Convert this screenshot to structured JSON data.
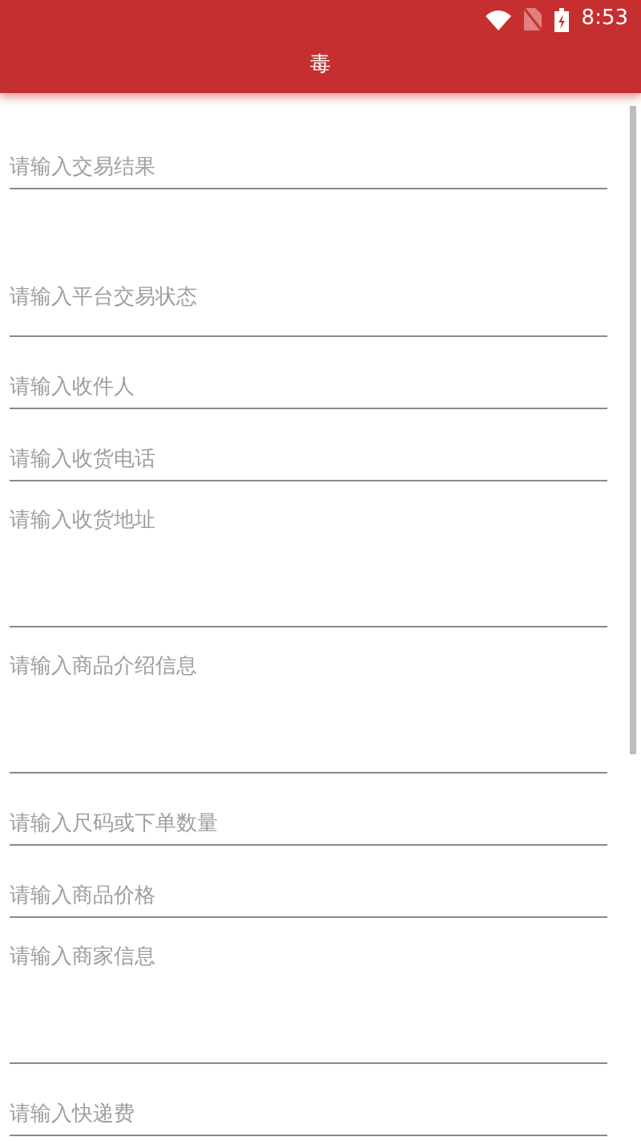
{
  "status_bar": {
    "time": "8:53"
  },
  "toolbar": {
    "title": "毒"
  },
  "fields": [
    {
      "kind": "first",
      "placeholder": "请输入交易结果"
    },
    {
      "kind": "tall",
      "placeholder": "请输入平台交易状态"
    },
    {
      "kind": "single",
      "placeholder": "请输入收件人"
    },
    {
      "kind": "single",
      "placeholder": "请输入收货电话"
    },
    {
      "kind": "multiline",
      "placeholder": "请输入收货地址"
    },
    {
      "kind": "multiline",
      "placeholder": "请输入商品介绍信息"
    },
    {
      "kind": "single",
      "placeholder": "请输入尺码或下单数量"
    },
    {
      "kind": "single",
      "placeholder": "请输入商品价格"
    },
    {
      "kind": "multiline",
      "placeholder": "请输入商家信息"
    },
    {
      "kind": "single",
      "placeholder": "请输入快递费"
    }
  ]
}
